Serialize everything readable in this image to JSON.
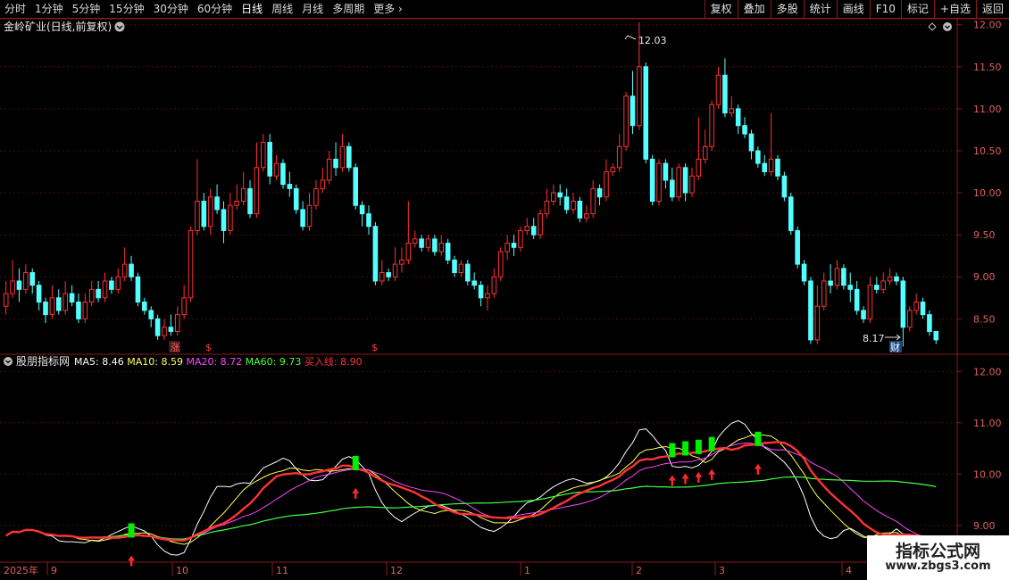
{
  "toolbar": {
    "periods": [
      "分时",
      "1分钟",
      "5分钟",
      "15分钟",
      "30分钟",
      "60分钟",
      "日线",
      "周线",
      "月线",
      "多周期",
      "更多"
    ],
    "active_period": "日线",
    "right_buttons": [
      "复权",
      "叠加",
      "多股",
      "统计",
      "画线",
      "F10",
      "标记",
      "+自选",
      "返回"
    ]
  },
  "main_panel": {
    "title": "金岭矿业(日线,前复权)",
    "y_ticks": [
      "12.00",
      "11.50",
      "11.00",
      "10.50",
      "10.00",
      "9.50",
      "9.00",
      "8.50"
    ],
    "high_label": "12.03",
    "low_label": "8.17",
    "markers": [
      "涨",
      "$",
      "$",
      "财"
    ]
  },
  "indicator_panel": {
    "title": "股朋指标网",
    "legend": [
      {
        "label": "MA5:",
        "value": "8.46",
        "color": "#ffffff"
      },
      {
        "label": "MA10:",
        "value": "8.59",
        "color": "#ffff55"
      },
      {
        "label": "MA20:",
        "value": "8.72",
        "color": "#ff44ff"
      },
      {
        "label": "MA60:",
        "value": "9.73",
        "color": "#44ff44"
      },
      {
        "label": "买入线:",
        "value": "8.90",
        "color": "#ff3333"
      }
    ],
    "y_ticks": [
      "12.00",
      "11.00",
      "10.00",
      "9.00"
    ]
  },
  "time_axis": {
    "labels": [
      "2025年",
      "9",
      "10",
      "11",
      "12",
      "1",
      "2",
      "3",
      "4"
    ]
  },
  "watermark": {
    "title": "指标公式网",
    "url": "www.zbgs3.com"
  },
  "colors": {
    "up": "#ff3232",
    "down": "#54ffff",
    "border": "#8b1a1a",
    "grid": "#4a0e0e",
    "axis_text": "#e06060"
  },
  "chart_data": {
    "type": "candlestick",
    "y_range_main": [
      8.1,
      12.05
    ],
    "y_range_indicator": [
      8.3,
      12.3
    ],
    "candles": [
      [
        8.65,
        8.8,
        8.55,
        8.95
      ],
      [
        8.8,
        8.95,
        8.75,
        9.2
      ],
      [
        8.95,
        8.85,
        8.7,
        9.1
      ],
      [
        8.85,
        9.05,
        8.8,
        9.15
      ],
      [
        9.05,
        8.9,
        8.8,
        9.1
      ],
      [
        8.9,
        8.7,
        8.6,
        8.95
      ],
      [
        8.7,
        8.55,
        8.45,
        8.75
      ],
      [
        8.55,
        8.75,
        8.5,
        8.9
      ],
      [
        8.75,
        8.6,
        8.55,
        8.85
      ],
      [
        8.6,
        8.8,
        8.55,
        8.95
      ],
      [
        8.8,
        8.7,
        8.65,
        8.9
      ],
      [
        8.7,
        8.5,
        8.45,
        8.8
      ],
      [
        8.5,
        8.7,
        8.45,
        8.8
      ],
      [
        8.7,
        8.85,
        8.65,
        8.95
      ],
      [
        8.85,
        8.75,
        8.7,
        8.95
      ],
      [
        8.75,
        8.95,
        8.7,
        9.05
      ],
      [
        8.95,
        8.85,
        8.8,
        9.0
      ],
      [
        8.85,
        9.0,
        8.8,
        9.1
      ],
      [
        9.0,
        9.15,
        8.95,
        9.35
      ],
      [
        9.15,
        9.0,
        8.95,
        9.25
      ],
      [
        9.0,
        8.7,
        8.65,
        9.05
      ],
      [
        8.7,
        8.6,
        8.55,
        8.75
      ],
      [
        8.6,
        8.5,
        8.4,
        8.65
      ],
      [
        8.5,
        8.3,
        8.25,
        8.55
      ],
      [
        8.3,
        8.4,
        8.25,
        8.5
      ],
      [
        8.4,
        8.35,
        8.3,
        8.55
      ],
      [
        8.35,
        8.55,
        8.3,
        8.65
      ],
      [
        8.55,
        8.75,
        8.5,
        8.9
      ],
      [
        8.75,
        9.55,
        8.7,
        9.6
      ],
      [
        9.55,
        9.9,
        9.5,
        10.4
      ],
      [
        9.9,
        9.6,
        9.55,
        10.0
      ],
      [
        9.6,
        9.95,
        9.5,
        10.05
      ],
      [
        9.95,
        9.8,
        9.75,
        10.1
      ],
      [
        9.8,
        9.55,
        9.4,
        9.9
      ],
      [
        9.55,
        9.85,
        9.5,
        10.0
      ],
      [
        9.85,
        9.9,
        9.8,
        10.1
      ],
      [
        9.9,
        10.05,
        9.85,
        10.25
      ],
      [
        10.05,
        9.75,
        9.7,
        10.15
      ],
      [
        9.75,
        10.3,
        9.7,
        10.6
      ],
      [
        10.3,
        10.6,
        10.25,
        10.7
      ],
      [
        10.6,
        10.2,
        10.1,
        10.7
      ],
      [
        10.2,
        10.35,
        10.15,
        10.45
      ],
      [
        10.35,
        10.1,
        10.05,
        10.4
      ],
      [
        10.1,
        10.05,
        9.95,
        10.25
      ],
      [
        10.05,
        9.8,
        9.75,
        10.1
      ],
      [
        9.8,
        9.6,
        9.55,
        9.9
      ],
      [
        9.6,
        9.85,
        9.55,
        10.0
      ],
      [
        9.85,
        10.05,
        9.8,
        10.15
      ],
      [
        10.05,
        10.15,
        10.0,
        10.3
      ],
      [
        10.15,
        10.4,
        10.1,
        10.5
      ],
      [
        10.4,
        10.3,
        10.2,
        10.6
      ],
      [
        10.3,
        10.55,
        10.25,
        10.7
      ],
      [
        10.55,
        10.3,
        10.25,
        10.6
      ],
      [
        10.3,
        9.85,
        9.8,
        10.35
      ],
      [
        9.85,
        9.75,
        9.6,
        9.9
      ],
      [
        9.75,
        9.6,
        9.5,
        9.85
      ],
      [
        9.6,
        8.95,
        8.9,
        9.65
      ],
      [
        8.95,
        9.05,
        8.9,
        9.2
      ],
      [
        9.05,
        9.0,
        8.95,
        9.1
      ],
      [
        9.0,
        9.15,
        8.95,
        9.35
      ],
      [
        9.15,
        9.2,
        9.05,
        9.35
      ],
      [
        9.2,
        9.4,
        9.15,
        9.9
      ],
      [
        9.4,
        9.45,
        9.35,
        9.55
      ],
      [
        9.45,
        9.35,
        9.3,
        9.5
      ],
      [
        9.35,
        9.45,
        9.3,
        9.5
      ],
      [
        9.45,
        9.3,
        9.25,
        9.5
      ],
      [
        9.3,
        9.4,
        9.25,
        9.5
      ],
      [
        9.4,
        9.2,
        9.15,
        9.45
      ],
      [
        9.2,
        9.05,
        9.0,
        9.25
      ],
      [
        9.05,
        9.15,
        9.0,
        9.2
      ],
      [
        9.15,
        8.95,
        8.9,
        9.2
      ],
      [
        8.95,
        8.9,
        8.85,
        9.05
      ],
      [
        8.9,
        8.75,
        8.65,
        8.95
      ],
      [
        8.75,
        8.8,
        8.6,
        8.9
      ],
      [
        8.8,
        9.0,
        8.75,
        9.1
      ],
      [
        9.0,
        9.3,
        8.95,
        9.35
      ],
      [
        9.3,
        9.4,
        9.2,
        9.5
      ],
      [
        9.4,
        9.35,
        9.25,
        9.5
      ],
      [
        9.35,
        9.55,
        9.3,
        9.6
      ],
      [
        9.55,
        9.6,
        9.5,
        9.7
      ],
      [
        9.6,
        9.5,
        9.45,
        9.7
      ],
      [
        9.5,
        9.75,
        9.45,
        9.8
      ],
      [
        9.75,
        9.9,
        9.7,
        10.05
      ],
      [
        9.9,
        10.0,
        9.85,
        10.1
      ],
      [
        10.0,
        9.95,
        9.85,
        10.1
      ],
      [
        9.95,
        9.8,
        9.75,
        10.05
      ],
      [
        9.8,
        9.9,
        9.75,
        10.0
      ],
      [
        9.9,
        9.7,
        9.65,
        9.95
      ],
      [
        9.7,
        9.75,
        9.65,
        9.85
      ],
      [
        9.75,
        10.05,
        9.7,
        10.15
      ],
      [
        10.05,
        9.95,
        9.85,
        10.1
      ],
      [
        9.95,
        10.25,
        9.9,
        10.4
      ],
      [
        10.25,
        10.3,
        10.2,
        10.35
      ],
      [
        10.3,
        10.55,
        10.25,
        10.7
      ],
      [
        10.55,
        11.15,
        10.5,
        11.2
      ],
      [
        11.15,
        10.8,
        10.7,
        11.45
      ],
      [
        10.8,
        11.5,
        10.75,
        12.03
      ],
      [
        11.5,
        10.4,
        10.35,
        11.55
      ],
      [
        10.4,
        9.9,
        9.85,
        10.45
      ],
      [
        9.9,
        10.35,
        9.85,
        10.4
      ],
      [
        10.35,
        10.15,
        10.05,
        10.4
      ],
      [
        10.15,
        9.95,
        9.9,
        10.3
      ],
      [
        9.95,
        10.3,
        9.9,
        10.35
      ],
      [
        10.3,
        10.0,
        9.9,
        10.35
      ],
      [
        10.0,
        10.2,
        9.95,
        10.3
      ],
      [
        10.2,
        10.4,
        10.15,
        10.9
      ],
      [
        10.4,
        10.55,
        10.35,
        10.75
      ],
      [
        10.55,
        11.05,
        10.5,
        11.1
      ],
      [
        11.05,
        11.4,
        11.0,
        11.5
      ],
      [
        11.4,
        10.95,
        10.9,
        11.6
      ],
      [
        10.95,
        11.0,
        10.9,
        11.15
      ],
      [
        11.0,
        10.8,
        10.7,
        11.05
      ],
      [
        10.8,
        10.7,
        10.65,
        10.9
      ],
      [
        10.7,
        10.5,
        10.4,
        10.75
      ],
      [
        10.5,
        10.35,
        10.3,
        10.55
      ],
      [
        10.35,
        10.25,
        10.2,
        10.45
      ],
      [
        10.25,
        10.4,
        10.2,
        10.95
      ],
      [
        10.4,
        10.2,
        10.15,
        10.45
      ],
      [
        10.2,
        9.95,
        9.9,
        10.25
      ],
      [
        9.95,
        9.55,
        9.5,
        10.0
      ],
      [
        9.55,
        9.15,
        9.1,
        9.6
      ],
      [
        9.15,
        8.95,
        8.9,
        9.2
      ],
      [
        8.95,
        8.25,
        8.2,
        9.0
      ],
      [
        8.25,
        8.65,
        8.2,
        8.9
      ],
      [
        8.65,
        8.95,
        8.6,
        9.05
      ],
      [
        8.95,
        8.9,
        8.8,
        9.15
      ],
      [
        8.9,
        9.1,
        8.85,
        9.2
      ],
      [
        9.1,
        8.9,
        8.85,
        9.15
      ],
      [
        8.9,
        8.85,
        8.7,
        9.05
      ],
      [
        8.85,
        8.6,
        8.55,
        8.95
      ],
      [
        8.6,
        8.5,
        8.45,
        8.65
      ],
      [
        8.5,
        8.9,
        8.45,
        9.0
      ],
      [
        8.9,
        8.85,
        8.8,
        9.0
      ],
      [
        8.85,
        8.95,
        8.8,
        9.05
      ],
      [
        8.95,
        9.0,
        8.9,
        9.1
      ],
      [
        9.0,
        8.95,
        8.9,
        9.05
      ],
      [
        8.95,
        8.4,
        8.17,
        9.0
      ],
      [
        8.4,
        8.6,
        8.35,
        8.65
      ],
      [
        8.6,
        8.7,
        8.55,
        8.8
      ],
      [
        8.7,
        8.55,
        8.5,
        8.75
      ],
      [
        8.55,
        8.35,
        8.3,
        8.6
      ],
      [
        8.35,
        8.25,
        8.2,
        8.35
      ]
    ],
    "indicator_signal_days": [
      19,
      53,
      101,
      103,
      105,
      107,
      114
    ],
    "buy_arrow_days": [
      19,
      53,
      101,
      103,
      105,
      107,
      114
    ]
  }
}
